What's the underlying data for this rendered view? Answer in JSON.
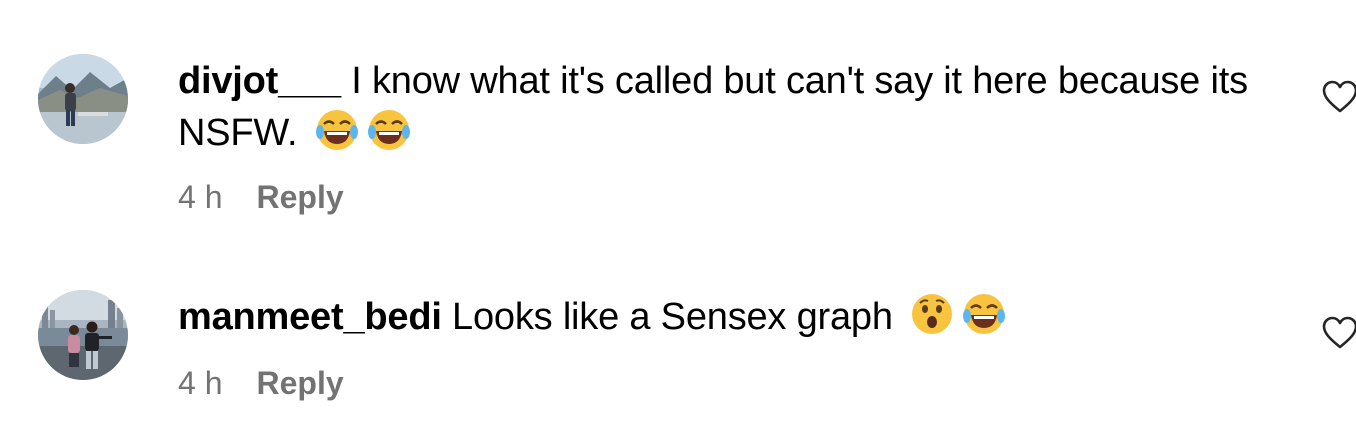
{
  "comments": [
    {
      "username": "divjot___",
      "text": " I know what it's called but can't say it here because its NSFW.",
      "emojis": [
        "face-with-tears-of-joy",
        "face-with-tears-of-joy"
      ],
      "time": "4 h",
      "reply_label": "Reply"
    },
    {
      "username": "manmeet_bedi",
      "text": " Looks like a Sensex graph",
      "emojis": [
        "astonished-face",
        "face-with-tears-of-joy"
      ],
      "time": "4 h",
      "reply_label": "Reply"
    }
  ],
  "colors": {
    "meta_gray": "#737373",
    "text": "#000000",
    "background": "#ffffff"
  }
}
